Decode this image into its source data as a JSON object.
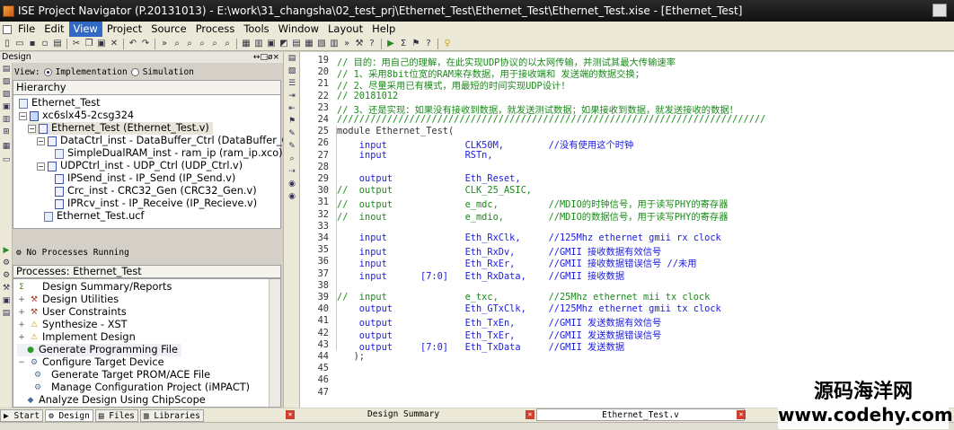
{
  "window": {
    "title": "ISE Project Navigator (P.20131013) - E:\\work\\31_changsha\\02_test_prj\\Ethernet_Test\\Ethernet_Test\\Ethernet_Test.xise - [Ethernet_Test]"
  },
  "menu": [
    "File",
    "Edit",
    "View",
    "Project",
    "Source",
    "Process",
    "Tools",
    "Window",
    "Layout",
    "Help"
  ],
  "menu_active": "View",
  "design_panel": {
    "title": "Design",
    "controls": "↔□ø×",
    "view_label": "View:",
    "view_impl": "Implementation",
    "view_sim": "Simulation",
    "hierarchy_title": "Hierarchy",
    "tree": [
      "Ethernet_Test",
      "xc6slx45-2csg324",
      "Ethernet_Test (Ethernet_Test.v)",
      "DataCtrl_inst - DataBuffer_Ctrl (DataBuffer_Ctrl.v)",
      "SimpleDualRAM_inst - ram_ip (ram_ip.xco)",
      "UDPCtrl_inst - UDP_Ctrl (UDP_Ctrl.v)",
      "IPSend_inst - IP_Send (IP_Send.v)",
      "Crc_inst - CRC32_Gen (CRC32_Gen.v)",
      "IPRcv_inst - IP_Receive (IP_Recieve.v)",
      "Ethernet_Test.ucf"
    ],
    "status": "No Processes Running",
    "processes_title": "Processes: Ethernet_Test",
    "processes": [
      "Design Summary/Reports",
      "Design Utilities",
      "User Constraints",
      "Synthesize - XST",
      "Implement Design",
      "Generate Programming File",
      "Configure Target Device",
      "Generate Target PROM/ACE File",
      "Manage Configuration Project (iMPACT)",
      "Analyze Design Using ChipScope"
    ],
    "bottom_tabs": [
      "Start",
      "Design",
      "Files",
      "Libraries"
    ]
  },
  "editor": {
    "lines": [
      {
        "n": "19",
        "t": "// 目的：用自己的理解，在此实现UDP协议的以太网传输，并测试其最大传输速率"
      },
      {
        "n": "20",
        "t": "// 1、采用8bit位宽的RAM来存数据，用于接收端和 发送端的数据交换；"
      },
      {
        "n": "21",
        "t": "// 2、尽量采用已有模式，用最短的时间实现UDP设计！"
      },
      {
        "n": "22",
        "t": "// 20181012"
      },
      {
        "n": "23",
        "t": "// 3、还是实现：如果没有接收到数据，就发送测试数据；如果接收到数据，就发送接收的数据！"
      },
      {
        "n": "24",
        "t": "/////////////////////////////////////////////////////////////////////////////"
      },
      {
        "n": "25",
        "t": "module Ethernet_Test("
      },
      {
        "n": "26",
        "t": "    input              CLK50M,        //没有使用这个时钟"
      },
      {
        "n": "27",
        "t": "    input              RSTn,"
      },
      {
        "n": "28",
        "t": ""
      },
      {
        "n": "29",
        "t": "    output             Eth_Reset,"
      },
      {
        "n": "30",
        "t": "//  output             CLK_25_ASIC,"
      },
      {
        "n": "31",
        "t": "//  output             e_mdc,         //MDIO的时钟信号，用于读写PHY的寄存器"
      },
      {
        "n": "32",
        "t": "//  inout              e_mdio,        //MDIO的数据信号，用于读写PHY的寄存器"
      },
      {
        "n": "33",
        "t": ""
      },
      {
        "n": "34",
        "t": "    input              Eth_RxClk,     //125Mhz ethernet gmii rx clock"
      },
      {
        "n": "35",
        "t": "    input              Eth_RxDv,      //GMII 接收数据有效信号"
      },
      {
        "n": "36",
        "t": "    input              Eth_RxEr,      //GMII 接收数据错误信号 //未用"
      },
      {
        "n": "37",
        "t": "    input      [7:0]   Eth_RxData,    //GMII 接收数据"
      },
      {
        "n": "38",
        "t": ""
      },
      {
        "n": "39",
        "t": "//  input              e_txc,         //25Mhz ethernet mii tx clock"
      },
      {
        "n": "40",
        "t": "    output             Eth_GTxClk,    //125Mhz ethernet gmii tx clock"
      },
      {
        "n": "41",
        "t": "    output             Eth_TxEn,      //GMII 发送数据有效信号"
      },
      {
        "n": "42",
        "t": "    output             Eth_TxEr,      //GMII 发送数据错误信号"
      },
      {
        "n": "43",
        "t": "    output     [7:0]   Eth_TxData     //GMII 发送数据"
      },
      {
        "n": "44",
        "t": "   );"
      },
      {
        "n": "45",
        "t": ""
      },
      {
        "n": "46",
        "t": ""
      },
      {
        "n": "47",
        "t": ""
      }
    ],
    "tabs": [
      "Design Summary",
      "Ethernet_Test.v"
    ]
  },
  "watermark": {
    "line1": "源码海洋网",
    "line2": "www.codehy.com"
  }
}
